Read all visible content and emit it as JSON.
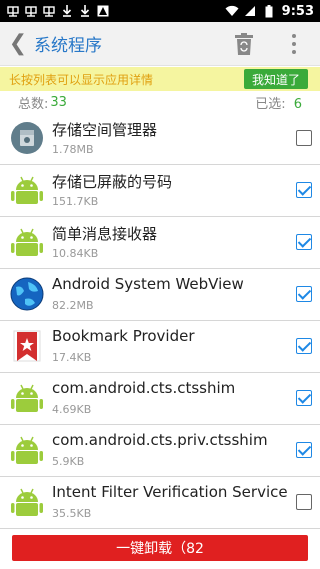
{
  "status_bar": {
    "time": "9:53",
    "left_icons": [
      "app-notify-icon",
      "app-notify-icon",
      "app-notify-icon",
      "download-icon",
      "download-icon",
      "warning-icon"
    ],
    "right_icons": [
      "wifi-icon",
      "signal-icon",
      "battery-icon"
    ]
  },
  "app_bar": {
    "back_label": "❮",
    "title": "系统程序"
  },
  "notice": {
    "text": "长按列表可以显示应用详情",
    "button": "我知道了"
  },
  "counts": {
    "total_label": "总数:",
    "total_value": "33",
    "selected_label": "已选:",
    "selected_value": "6"
  },
  "apps": [
    {
      "name": "存储空间管理器",
      "size": "1.78MB",
      "icon": "storage-manager-icon",
      "checked": false
    },
    {
      "name": "存储已屏蔽的号码",
      "size": "151.7KB",
      "icon": "android-icon",
      "checked": true
    },
    {
      "name": "简单消息接收器",
      "size": "10.84KB",
      "icon": "android-icon",
      "checked": true
    },
    {
      "name": "Android System WebView",
      "size": "82.2MB",
      "icon": "webview-globe-icon",
      "checked": true
    },
    {
      "name": "Bookmark Provider",
      "size": "17.4KB",
      "icon": "bookmark-star-icon",
      "checked": true
    },
    {
      "name": "com.android.cts.ctsshim",
      "size": "4.69KB",
      "icon": "android-icon",
      "checked": true
    },
    {
      "name": "com.android.cts.priv.ctsshim",
      "size": "5.9KB",
      "icon": "android-icon",
      "checked": true
    },
    {
      "name": "Intent Filter Verification Service",
      "size": "35.5KB",
      "icon": "android-icon",
      "checked": false
    }
  ],
  "bottom_button": {
    "label": "一键卸载（82"
  },
  "colors": {
    "title_blue": "#2878c8",
    "notice_bg": "#f5f5a0",
    "notice_text": "#e0a010",
    "green": "#3aaa3a",
    "android_green": "#9ccc3c",
    "check_blue": "#1e88e5",
    "uninstall_red": "#e02020"
  }
}
